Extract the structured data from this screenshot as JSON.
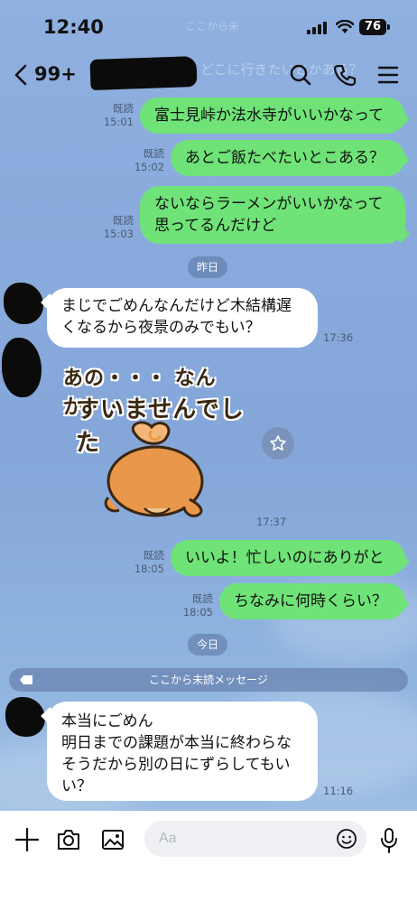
{
  "status_bar": {
    "time": "12:40",
    "battery": "76",
    "ghost_text": "ここから未"
  },
  "header": {
    "unread_count": "99+",
    "ghost_preview": "どこに行きたいとかある？",
    "icons": [
      "chevron-left-icon",
      "search-icon",
      "phone-icon",
      "menu-icon"
    ]
  },
  "messages": [
    {
      "side": "out",
      "text": "富士見峠か法水寺がいいかなって",
      "read": "既読",
      "time": "15:01"
    },
    {
      "side": "out",
      "text": "あとご飯たべたいとこある？",
      "read": "既読",
      "time": "15:02"
    },
    {
      "side": "out",
      "lines": [
        "ないならラーメンがいいかなって",
        "思ってるんだけど"
      ],
      "read": "既読",
      "time": "15:03"
    },
    {
      "side": "in",
      "lines": [
        "まじでごめんなんだけど木結構遅",
        "くなるから夜景のみでもい？"
      ],
      "time": "17:36"
    },
    {
      "side": "in",
      "type": "sticker",
      "lines": [
        "あの・・・ なんか・・・",
        "すいませんでした"
      ],
      "time": "17:37"
    },
    {
      "side": "out",
      "text": "いいよ！忙しいのにありがと",
      "read": "既読",
      "time": "18:05"
    },
    {
      "side": "out",
      "text": "ちなみに何時くらい？",
      "read": "既読",
      "time": "18:05"
    },
    {
      "side": "in",
      "lines": [
        "本当にごめん",
        "明日までの課題が本当に終わらな",
        "そうだから別の日にずらしてもい",
        "い？"
      ],
      "time": "11:16"
    }
  ],
  "date_separators": {
    "yesterday": "昨日",
    "today": "今日"
  },
  "unread_divider": "ここから未読メッセージ",
  "composer": {
    "placeholder": "Aa",
    "icons": [
      "plus-icon",
      "camera-icon",
      "image-icon",
      "emoji-icon",
      "microphone-icon"
    ]
  },
  "colors": {
    "background": "#88a8d8",
    "outgoing_bubble": "#6fe377",
    "incoming_bubble": "#ffffff"
  }
}
